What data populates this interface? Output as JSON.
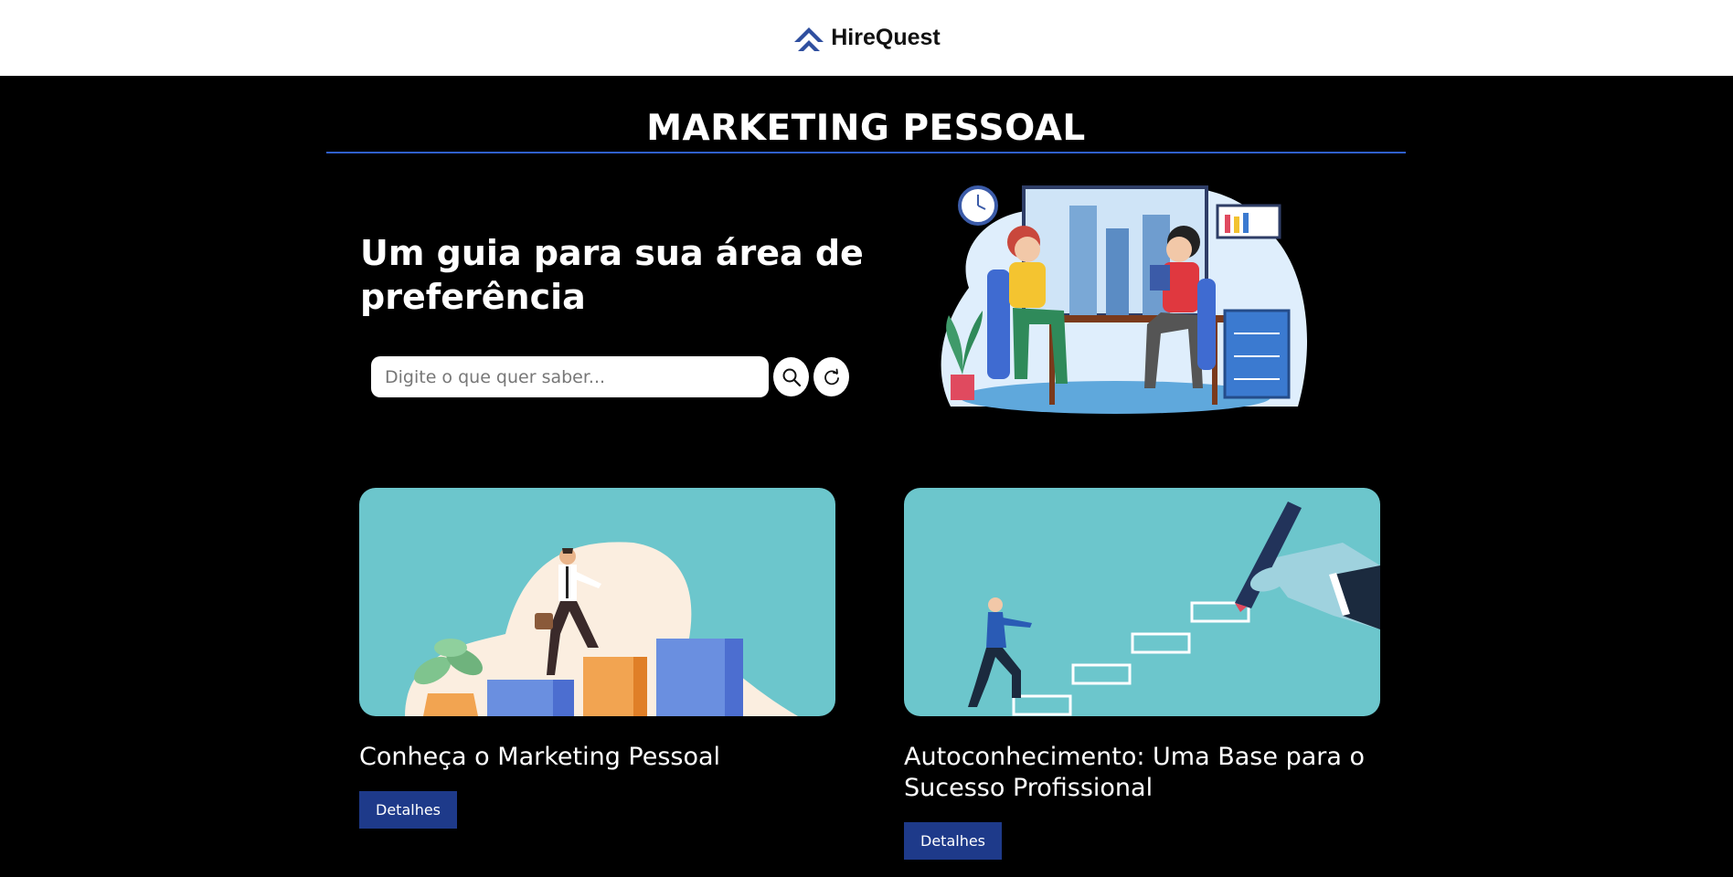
{
  "header": {
    "brand": "HireQuest",
    "logo_icon": "chevron-up-logo-icon",
    "brand_color": "#2f4f9f"
  },
  "page": {
    "title": "MARKETING PESSOAL",
    "accent": "#2f5fcc"
  },
  "hero": {
    "heading": "Um guia para sua área de preferência",
    "search_placeholder": "Digite o que quer saber...",
    "search_icon": "search-icon",
    "reset_icon": "refresh-icon",
    "illustration": "office-meeting-illustration"
  },
  "cards": [
    {
      "title": "Conheça o Marketing Pessoal",
      "button": "Detalhes",
      "image": "man-climbing-bars-illustration"
    },
    {
      "title": "Autoconhecimento: Uma Base para o Sucesso Profissional",
      "button": "Detalhes",
      "image": "hand-drawing-stairs-illustration"
    }
  ],
  "colors": {
    "background": "#000000",
    "card_bg": "#6cc6cc",
    "button_bg": "#1e3a8a"
  }
}
